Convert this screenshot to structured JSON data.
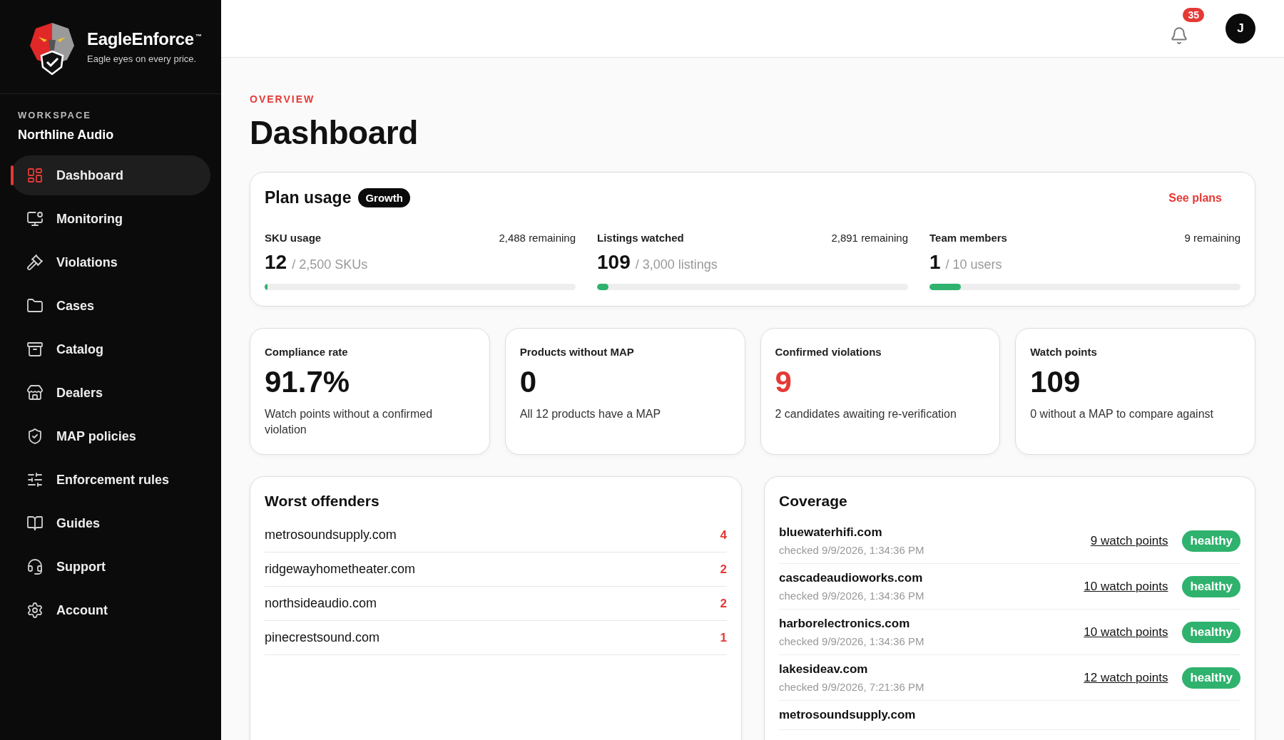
{
  "brand": {
    "name": "EagleEnforce",
    "trademark": "™",
    "tagline": "Eagle eyes on every price."
  },
  "workspace": {
    "label": "WORKSPACE",
    "name": "Northline Audio"
  },
  "sidebar": {
    "items": [
      {
        "label": "Dashboard",
        "selected": true
      },
      {
        "label": "Monitoring",
        "selected": false
      },
      {
        "label": "Violations",
        "selected": false
      },
      {
        "label": "Cases",
        "selected": false
      },
      {
        "label": "Catalog",
        "selected": false
      },
      {
        "label": "Dealers",
        "selected": false
      },
      {
        "label": "MAP policies",
        "selected": false
      },
      {
        "label": "Enforcement rules",
        "selected": false
      },
      {
        "label": "Guides",
        "selected": false
      },
      {
        "label": "Support",
        "selected": false
      },
      {
        "label": "Account",
        "selected": false
      }
    ]
  },
  "topbar": {
    "notifications": "35",
    "avatar": "J"
  },
  "page": {
    "eyebrow": "OVERVIEW",
    "title": "Dashboard"
  },
  "plan_usage": {
    "title": "Plan usage",
    "plan": "Growth",
    "link": "See plans",
    "meters": [
      {
        "label": "SKU usage",
        "remaining": "2,488 remaining",
        "value": "12",
        "limit": "/ 2,500 SKUs",
        "level": 0.005
      },
      {
        "label": "Listings watched",
        "remaining": "2,891 remaining",
        "value": "109",
        "limit": "/ 3,000 listings",
        "level": 0.036
      },
      {
        "label": "Team members",
        "remaining": "9 remaining",
        "value": "1",
        "limit": "/ 10 users",
        "level": 0.1
      }
    ]
  },
  "stats": [
    {
      "label": "Compliance rate",
      "value": "91.7%",
      "note": "Watch points without a confirmed violation",
      "alert": false
    },
    {
      "label": "Products without MAP",
      "value": "0",
      "note": "All 12 products have a MAP",
      "alert": false
    },
    {
      "label": "Confirmed violations",
      "value": "9",
      "note": "2 candidates awaiting re-verification",
      "alert": true
    },
    {
      "label": "Watch points",
      "value": "109",
      "note": "0 without a MAP to compare against",
      "alert": false
    }
  ],
  "worst_offenders": {
    "title": "Worst offenders",
    "rows": [
      {
        "domain": "metrosoundsupply.com",
        "count": "4"
      },
      {
        "domain": "ridgewayhometheater.com",
        "count": "2"
      },
      {
        "domain": "northsideaudio.com",
        "count": "2"
      },
      {
        "domain": "pinecrestsound.com",
        "count": "1"
      }
    ]
  },
  "coverage": {
    "title": "Coverage",
    "rows": [
      {
        "domain": "bluewaterhifi.com",
        "checked": "checked 9/9/2026, 1:34:36 PM",
        "watch_points": "9 watch points",
        "status": "healthy"
      },
      {
        "domain": "cascadeaudioworks.com",
        "checked": "checked 9/9/2026, 1:34:36 PM",
        "watch_points": "10 watch points",
        "status": "healthy"
      },
      {
        "domain": "harborelectronics.com",
        "checked": "checked 9/9/2026, 1:34:36 PM",
        "watch_points": "10 watch points",
        "status": "healthy"
      },
      {
        "domain": "lakesideav.com",
        "checked": "checked 9/9/2026, 7:21:36 PM",
        "watch_points": "12 watch points",
        "status": "healthy"
      },
      {
        "domain": "metrosoundsupply.com"
      }
    ]
  }
}
